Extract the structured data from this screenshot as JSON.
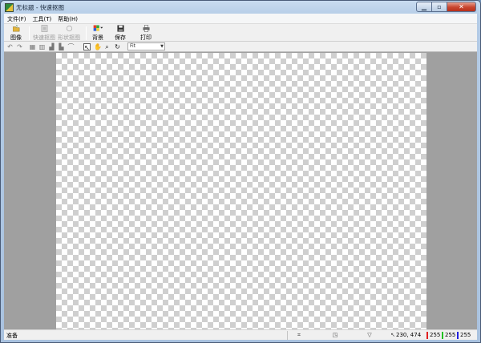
{
  "window": {
    "title": "无标题 - 快速抠图"
  },
  "menu": [
    {
      "label": "文件(F)"
    },
    {
      "label": "工具(T)"
    },
    {
      "label": "帮助(H)"
    }
  ],
  "toolbar": {
    "image_label": "图像",
    "quick_cutout_label": "快速抠图",
    "shape_cutout_label": "形状抠图",
    "background_label": "背景",
    "save_label": "保存",
    "print_label": "打印"
  },
  "zoom": {
    "value": "Fit"
  },
  "status": {
    "ready": "准备",
    "coords": "230, 474",
    "r": "255",
    "g": "255",
    "b": "255"
  },
  "colors": {
    "red": "#e02020",
    "green": "#20c020",
    "blue": "#2020e0",
    "workspace": "#a0a0a0"
  }
}
